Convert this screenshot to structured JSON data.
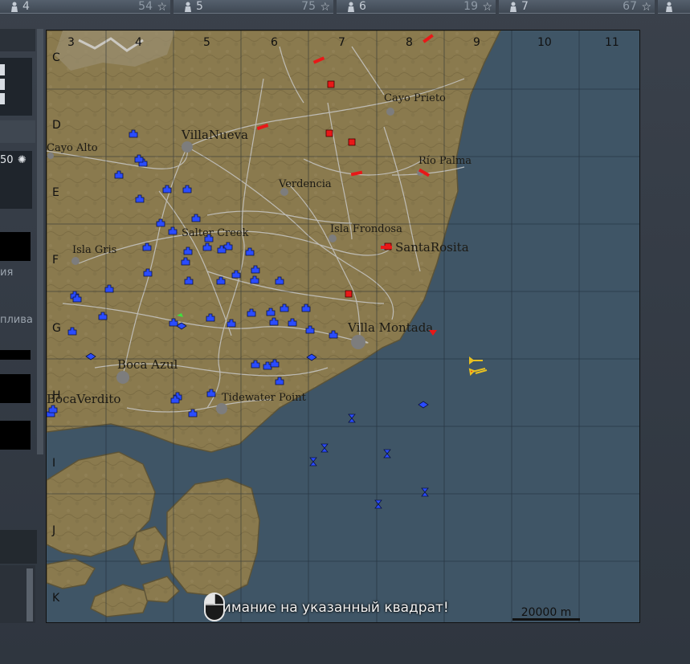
{
  "squad_slots": [
    {
      "num": "4",
      "score": "54"
    },
    {
      "num": "5",
      "score": "75"
    },
    {
      "num": "6",
      "score": "19"
    },
    {
      "num": "7",
      "score": "67"
    }
  ],
  "side": {
    "value": "50",
    "text_a": "ия",
    "text_b": "плива"
  },
  "map": {
    "grid_cols": [
      "3",
      "4",
      "5",
      "6",
      "7",
      "8",
      "9",
      "10",
      "11"
    ],
    "grid_rows": [
      "C",
      "D",
      "E",
      "F",
      "G",
      "H",
      "I",
      "J",
      "K"
    ],
    "places": {
      "cayo_prieto": "Cayo Prieto",
      "villa_nueva": "VillaNueva",
      "cayo_alto": "Cayo Alto",
      "rio_palma": "Río Palma",
      "verdencia": "Verdencia",
      "salter_creek": "Salter Creek",
      "isla_frondosa": "Isla Frondosa",
      "santa_rosita": "SantaRosita",
      "isla_gris": "Isla Gris",
      "villa_montada": "Villa Montada",
      "boca_azul": "Boca Azul",
      "boca_verdito": "BocaVerdito",
      "tidewater_point": "Tidewater Point"
    },
    "colors": {
      "land": "#8a7a4e",
      "sea": "#3f5566",
      "friendly": "#2a4cff",
      "enemy": "#e81818",
      "player": "#e8c020"
    }
  },
  "notice": "Внимание на указанный квадрат!",
  "scale_label": "20000 m"
}
